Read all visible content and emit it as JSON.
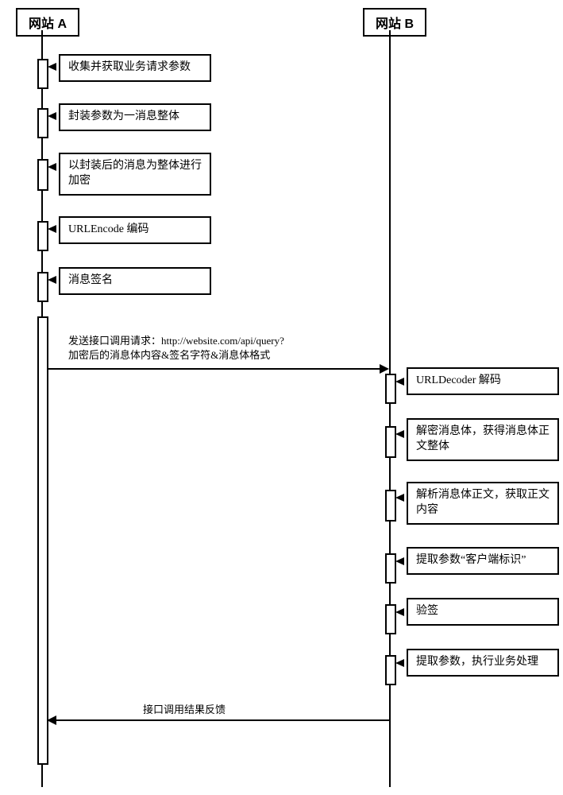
{
  "participants": {
    "a": {
      "label": "网站 A"
    },
    "b": {
      "label": "网站 B"
    }
  },
  "steps_a": [
    {
      "text": "收集并获取业务请求参数"
    },
    {
      "text": "封装参数为一消息整体"
    },
    {
      "text": "以封装后的消息为整体进行加密"
    },
    {
      "text": "URLEncode 编码"
    },
    {
      "text": "消息签名"
    }
  ],
  "request": {
    "line1": "发送接口调用请求：http://website.com/api/query?",
    "line2": "加密后的消息体内容&签名字符&消息体格式"
  },
  "steps_b": [
    {
      "text": "URLDecoder 解码"
    },
    {
      "text": "解密消息体，获得消息体正文整体"
    },
    {
      "text": "解析消息体正文，获取正文内容"
    },
    {
      "text": "提取参数“客户端标识”"
    },
    {
      "text": "验签"
    },
    {
      "text": "提取参数，执行业务处理"
    }
  ],
  "response": {
    "label": "接口调用结果反馈"
  }
}
